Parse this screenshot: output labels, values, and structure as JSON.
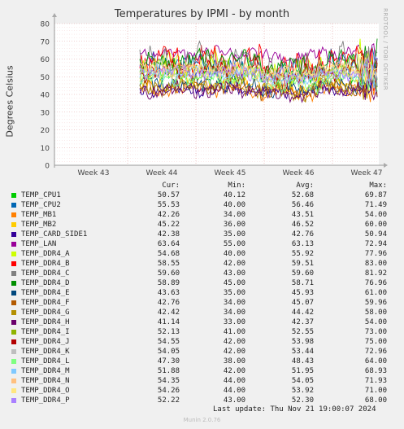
{
  "title": "Temperatures by IPMI - by month",
  "side_text": "RRDTOOL / TOBI OETIKER",
  "footer": {
    "last_update": "Last update: Thu Nov 21 19:00:07 2024",
    "munin": "Munin 2.0.76"
  },
  "legend_headers": {
    "cur": "Cur:",
    "min": "Min:",
    "avg": "Avg:",
    "max": "Max:"
  },
  "chart_data": {
    "type": "line",
    "title": "Temperatures by IPMI - by month",
    "ylabel": "Degrees Celsius",
    "ylim": [
      0,
      80
    ],
    "yticks": [
      0,
      10,
      20,
      30,
      40,
      50,
      60,
      70,
      80
    ],
    "xticks": [
      "Week 43",
      "Week 44",
      "Week 45",
      "Week 46",
      "Week 47"
    ],
    "grid": true,
    "data_starts_at": "Week 44",
    "series": [
      {
        "name": "TEMP_CPU1",
        "color": "#00cc00",
        "cur": "50.57",
        "min": "40.12",
        "avg": "52.68",
        "max": "69.87"
      },
      {
        "name": "TEMP_CPU2",
        "color": "#0066b3",
        "cur": "55.53",
        "min": "40.00",
        "avg": "56.46",
        "max": "71.49"
      },
      {
        "name": "TEMP_MB1",
        "color": "#ff8000",
        "cur": "42.26",
        "min": "34.00",
        "avg": "43.51",
        "max": "54.00"
      },
      {
        "name": "TEMP_MB2",
        "color": "#ffcc00",
        "cur": "45.22",
        "min": "36.00",
        "avg": "46.52",
        "max": "60.00"
      },
      {
        "name": "TEMP_CARD_SIDE1",
        "color": "#330099",
        "cur": "42.38",
        "min": "35.00",
        "avg": "42.76",
        "max": "50.94"
      },
      {
        "name": "TEMP_LAN",
        "color": "#990099",
        "cur": "63.64",
        "min": "55.00",
        "avg": "63.13",
        "max": "72.94"
      },
      {
        "name": "TEMP_DDR4_A",
        "color": "#ccff00",
        "cur": "54.68",
        "min": "40.00",
        "avg": "55.92",
        "max": "77.96"
      },
      {
        "name": "TEMP_DDR4_B",
        "color": "#ff0000",
        "cur": "58.55",
        "min": "42.00",
        "avg": "59.51",
        "max": "83.00"
      },
      {
        "name": "TEMP_DDR4_C",
        "color": "#808080",
        "cur": "59.60",
        "min": "43.00",
        "avg": "59.60",
        "max": "81.92"
      },
      {
        "name": "TEMP_DDR4_D",
        "color": "#008f00",
        "cur": "58.89",
        "min": "45.00",
        "avg": "58.71",
        "max": "76.96"
      },
      {
        "name": "TEMP_DDR4_E",
        "color": "#00487d",
        "cur": "43.63",
        "min": "35.00",
        "avg": "45.93",
        "max": "61.00"
      },
      {
        "name": "TEMP_DDR4_F",
        "color": "#b35a00",
        "cur": "42.76",
        "min": "34.00",
        "avg": "45.07",
        "max": "59.96"
      },
      {
        "name": "TEMP_DDR4_G",
        "color": "#b38f00",
        "cur": "42.42",
        "min": "34.00",
        "avg": "44.42",
        "max": "58.00"
      },
      {
        "name": "TEMP_DDR4_H",
        "color": "#6b006b",
        "cur": "41.14",
        "min": "33.00",
        "avg": "42.37",
        "max": "54.00"
      },
      {
        "name": "TEMP_DDR4_I",
        "color": "#8fb300",
        "cur": "52.13",
        "min": "41.00",
        "avg": "52.55",
        "max": "73.00"
      },
      {
        "name": "TEMP_DDR4_J",
        "color": "#b30000",
        "cur": "54.55",
        "min": "42.00",
        "avg": "53.98",
        "max": "75.00"
      },
      {
        "name": "TEMP_DDR4_K",
        "color": "#bebebe",
        "cur": "54.05",
        "min": "42.00",
        "avg": "53.44",
        "max": "72.96"
      },
      {
        "name": "TEMP_DDR4_L",
        "color": "#80ff80",
        "cur": "47.30",
        "min": "38.00",
        "avg": "48.43",
        "max": "64.00"
      },
      {
        "name": "TEMP_DDR4_M",
        "color": "#80c9ff",
        "cur": "51.88",
        "min": "42.00",
        "avg": "51.95",
        "max": "68.93"
      },
      {
        "name": "TEMP_DDR4_N",
        "color": "#ffc080",
        "cur": "54.35",
        "min": "44.00",
        "avg": "54.05",
        "max": "71.93"
      },
      {
        "name": "TEMP_DDR4_O",
        "color": "#ffe680",
        "cur": "54.26",
        "min": "44.00",
        "avg": "53.92",
        "max": "71.00"
      },
      {
        "name": "TEMP_DDR4_P",
        "color": "#aa80ff",
        "cur": "52.22",
        "min": "43.00",
        "avg": "52.30",
        "max": "68.00"
      }
    ]
  }
}
